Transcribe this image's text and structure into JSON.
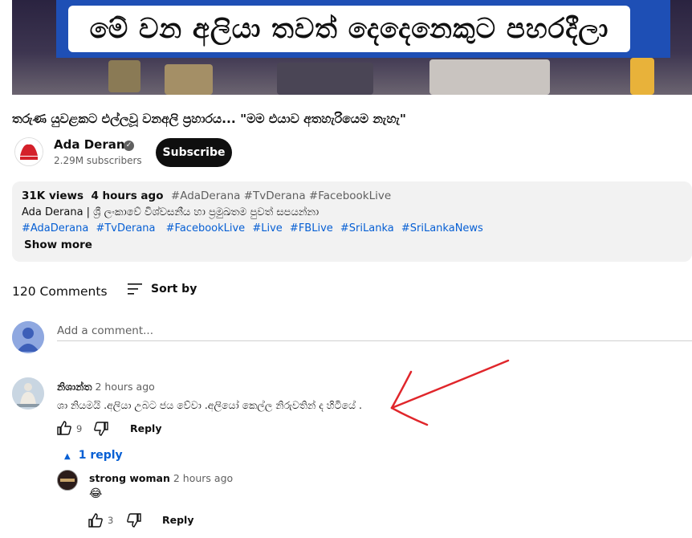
{
  "video": {
    "banner_text": "මේ වන අලියා තවත් දෙදෙනෙකුට පහරදීලා"
  },
  "title": "තරුණ යුවළකට එල්ලවූ වනඅලි ප්‍රහාරය... \"මම එයාව අතහැරියෙම නැහැ\"",
  "channel": {
    "name": "Ada Derana",
    "verified_icon": "verified-check-icon",
    "subscribers": "2.29M subscribers",
    "subscribe_label": "Subscribe"
  },
  "description": {
    "views": "31K views",
    "age": "4 hours ago",
    "top_tags": "#AdaDerana #TvDerana #FacebookLive",
    "text": "Ada Derana | ශ්‍රී ලංකාවේ විශ්වසනීය හා ප්‍රමුඛතම පුවත් සපයන්නා",
    "tags": [
      "#AdaDerana",
      "#TvDerana",
      "#FacebookLive",
      "#Live",
      "#FBLive",
      "#SriLanka",
      "#SriLankaNews"
    ],
    "show_more": "Show more"
  },
  "comments": {
    "count_label": "120 Comments",
    "sort_label": "Sort by",
    "sort_icon": "sort-lines-icon",
    "add_placeholder": "Add a comment...",
    "items": [
      {
        "author": "නිශාන්ත",
        "time": "2 hours ago",
        "text": "ශා නියමයි .අලියා  උබට ජය  වේවා .අලියෝ කෙල්ල නිරුවතින් ද හිටියේ .",
        "likes": "9",
        "reply_label": "Reply",
        "replies_toggle": "1 reply"
      },
      {
        "author": "strong woman",
        "time": "2 hours ago",
        "text": "😂",
        "likes": "3",
        "reply_label": "Reply"
      }
    ]
  },
  "colors": {
    "link_blue": "#065fd4",
    "annotation_red": "#e0262b",
    "subscribe_bg": "#0f0f0f"
  }
}
